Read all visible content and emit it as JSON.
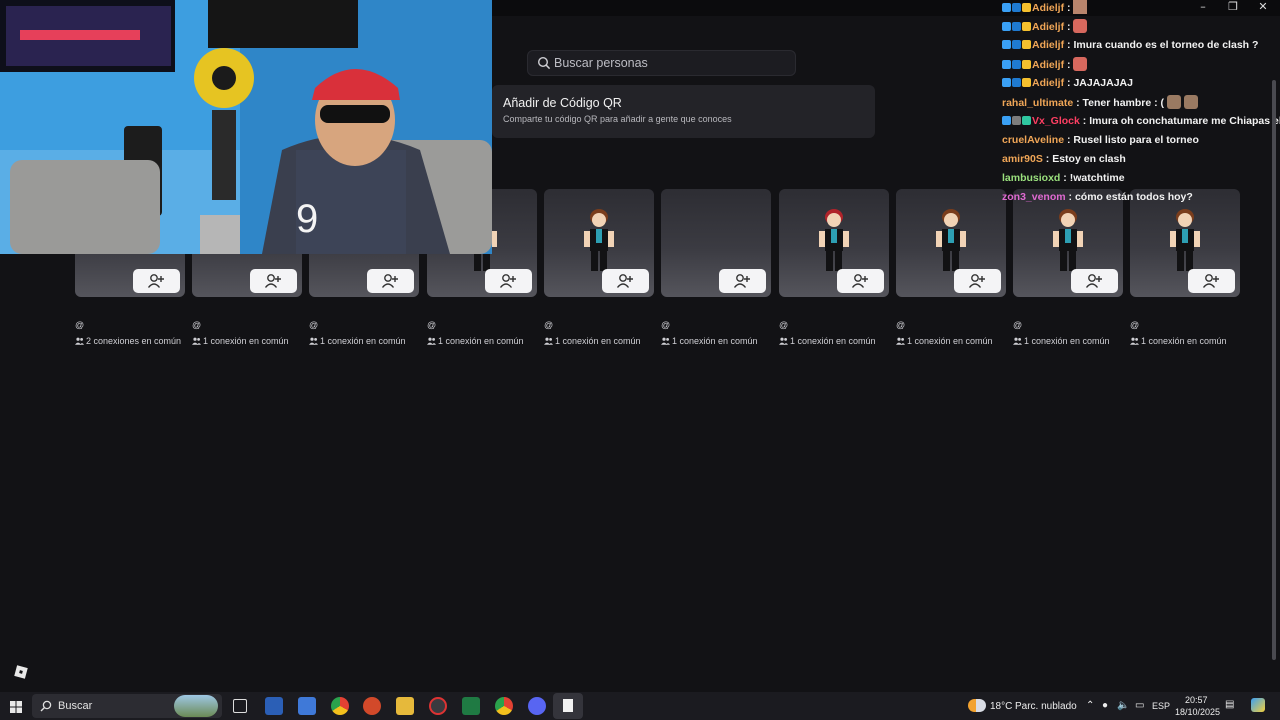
{
  "search": {
    "placeholder": "Buscar personas"
  },
  "qr": {
    "title": "Añadir de Código QR",
    "subtitle": "Comparte tu código QR para añadir a gente que conoces"
  },
  "cards": [
    {
      "handle": "@",
      "mutual": "2 conexiones en común"
    },
    {
      "handle": "@",
      "mutual": "1 conexión en común"
    },
    {
      "handle": "@",
      "mutual": "1 conexión en común"
    },
    {
      "handle": "@",
      "mutual": "1 conexión en común"
    },
    {
      "handle": "@",
      "mutual": "1 conexión en común"
    },
    {
      "handle": "@",
      "mutual": "1 conexión en común"
    },
    {
      "handle": "@",
      "mutual": "1 conexión en común"
    },
    {
      "handle": "@",
      "mutual": "1 conexión en común"
    },
    {
      "handle": "@",
      "mutual": "1 conexión en común"
    },
    {
      "handle": "@",
      "mutual": "1 conexión en común"
    }
  ],
  "chat": [
    {
      "user": "Adieljf",
      "sep": " : ",
      "text": "",
      "color": "#f0a657"
    },
    {
      "user": "Adieljf",
      "sep": " : ",
      "text": "",
      "color": "#f0a657"
    },
    {
      "user": "Adieljf",
      "sep": " : ",
      "text": "Imura cuando es el torneo de clash ?",
      "color": "#f0a657"
    },
    {
      "user": "Adieljf",
      "sep": " : ",
      "text": "",
      "color": "#f0a657"
    },
    {
      "user": "Adieljf",
      "sep": " : ",
      "text": "JAJAJAJAJ",
      "color": "#f0a657"
    },
    {
      "user": "rahal_ultimate",
      "sep": " : ",
      "text": "Tener hambre : (",
      "color": "#f0a657"
    },
    {
      "user": "Vx_Glock",
      "sep": " : ",
      "text": "Imura oh conchatumare me Chiapas el hue",
      "color": "#ff3f63"
    },
    {
      "user": "cruelAveline",
      "sep": " : ",
      "text": "Rusel listo para el torneo",
      "color": "#f0a657"
    },
    {
      "user": "amir90S",
      "sep": " : ",
      "text": "Estoy en clash",
      "color": "#f0a657"
    },
    {
      "user": "lambusioxd",
      "sep": " : ",
      "text": "!watchtime",
      "color": "#9ae07d"
    },
    {
      "user": "zon3_venom",
      "sep": " : ",
      "text": "cómo están todos hoy?",
      "color": "#e06ad1"
    }
  ],
  "taskbar": {
    "search_label": "Buscar",
    "weather_temp": "18°C",
    "weather_desc": "Parc. nublado",
    "lang": "ESP",
    "time": "20:57",
    "date": "18/10/2025"
  }
}
